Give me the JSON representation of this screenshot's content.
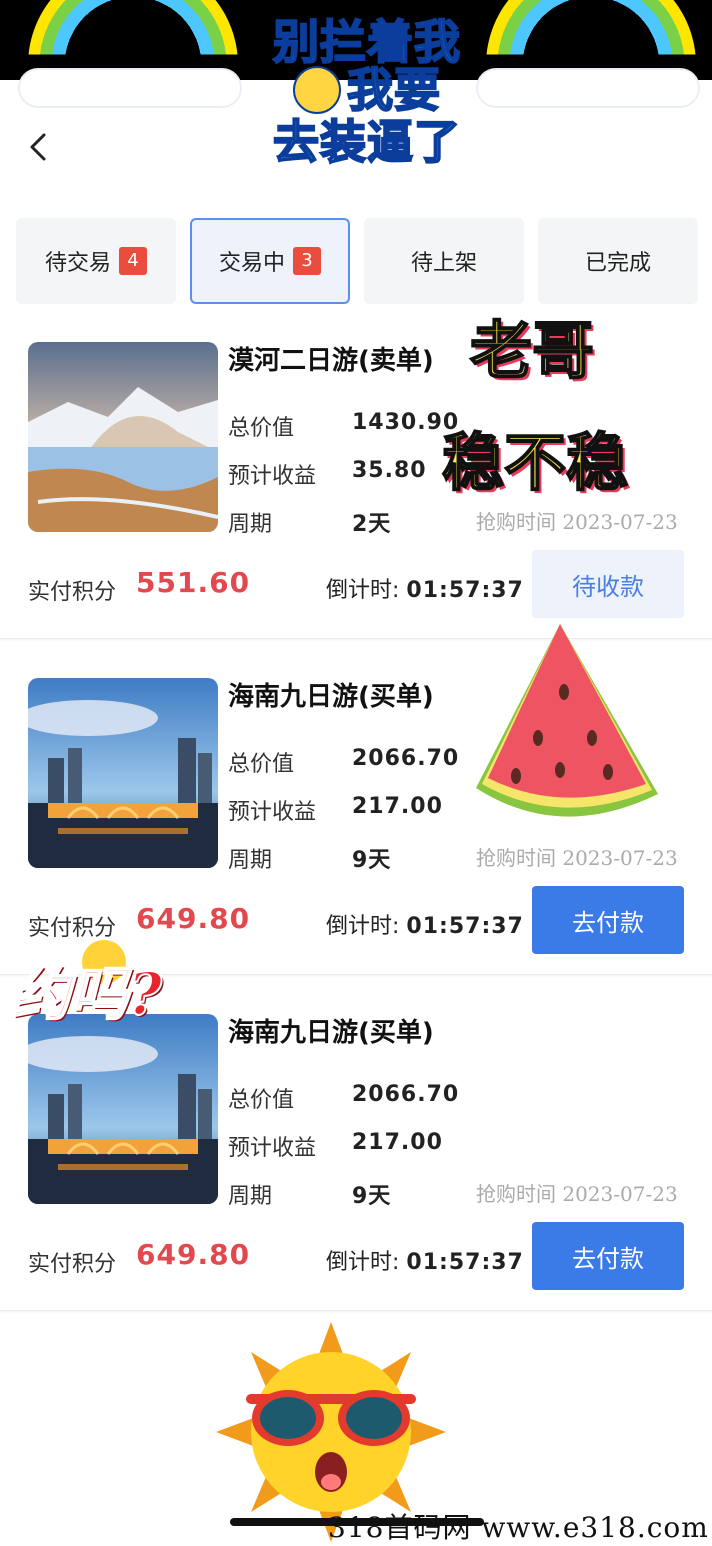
{
  "stickers": {
    "top_line1": "别拦着我",
    "top_line2": "我要",
    "top_line3": "去装逼了",
    "mid_line1": "老哥",
    "mid_line2": "稳不稳",
    "left": "约吗?"
  },
  "tabs": [
    {
      "label": "待交易",
      "badge": "4"
    },
    {
      "label": "交易中",
      "badge": "3"
    },
    {
      "label": "待上架",
      "badge": ""
    },
    {
      "label": "已完成",
      "badge": ""
    }
  ],
  "labels": {
    "total": "总价值",
    "profit": "预计收益",
    "period": "周期",
    "paid": "实付积分",
    "countdown": "倒计时:"
  },
  "orders": [
    {
      "title": "漠河二日游(卖单)",
      "total": "1430.90",
      "profit": "35.80",
      "period": "2天",
      "purchase_time": "抢购时间 2023-07-23",
      "paid": "551.60",
      "countdown": "01:57:37",
      "button": "待收款"
    },
    {
      "title": "海南九日游(买单)",
      "total": "2066.70",
      "profit": "217.00",
      "period": "9天",
      "purchase_time": "抢购时间 2023-07-23",
      "paid": "649.80",
      "countdown": "01:57:37",
      "button": "去付款"
    },
    {
      "title": "海南九日游(买单)",
      "total": "2066.70",
      "profit": "217.00",
      "period": "9天",
      "purchase_time": "抢购时间 2023-07-23",
      "paid": "649.80",
      "countdown": "01:57:37",
      "button": "去付款"
    }
  ],
  "watermark": "318首码网  www.e318.com",
  "colors": {
    "accent": "#3a7be8",
    "price": "#e2484e",
    "badge": "#ea4c3d"
  }
}
